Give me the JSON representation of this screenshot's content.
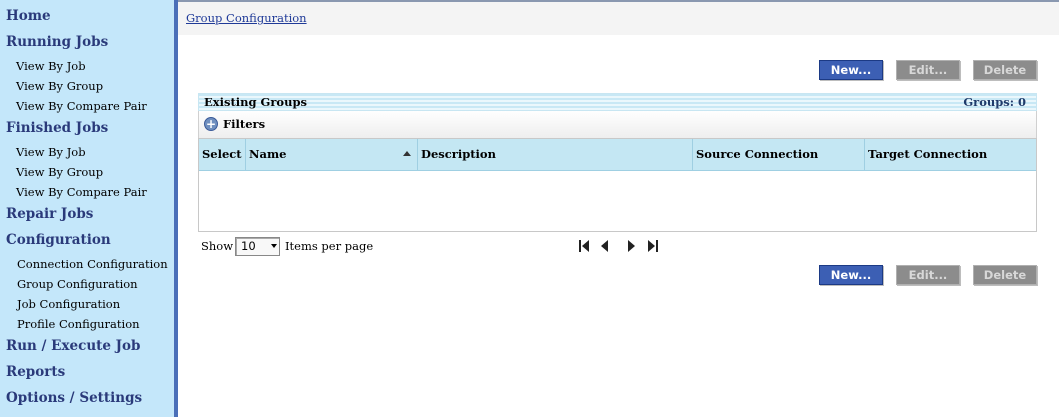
{
  "sidebar": {
    "home": "Home",
    "running_jobs": {
      "label": "Running Jobs",
      "items": [
        "View By Job",
        "View By Group",
        "View By Compare Pair"
      ]
    },
    "finished_jobs": {
      "label": "Finished Jobs",
      "items": [
        "View By Job",
        "View By Group",
        "View By Compare Pair"
      ]
    },
    "repair_jobs": "Repair Jobs",
    "configuration": {
      "label": "Configuration",
      "items": [
        "Connection Configuration",
        "Group Configuration",
        "Job Configuration",
        "Profile Configuration"
      ]
    },
    "run_execute": "Run / Execute Job",
    "reports": "Reports",
    "options": "Options / Settings"
  },
  "breadcrumb": "Group Configuration",
  "buttons": {
    "new": "New...",
    "edit": "Edit...",
    "delete": "Delete"
  },
  "panel": {
    "title": "Existing Groups",
    "count": "Groups: 0",
    "filters": "Filters"
  },
  "table": {
    "columns": [
      "Select",
      "Name",
      "Description",
      "Source Connection",
      "Target Connection"
    ]
  },
  "paging": {
    "show": "Show",
    "page_size": "10",
    "items_per_page": "Items per page"
  },
  "colors": {
    "sidebar_bg": "#c4e7fa",
    "nav_heading": "#2a3a7a",
    "primary_button": "#3c5fb4",
    "disabled_button": "#8c8c8c"
  }
}
